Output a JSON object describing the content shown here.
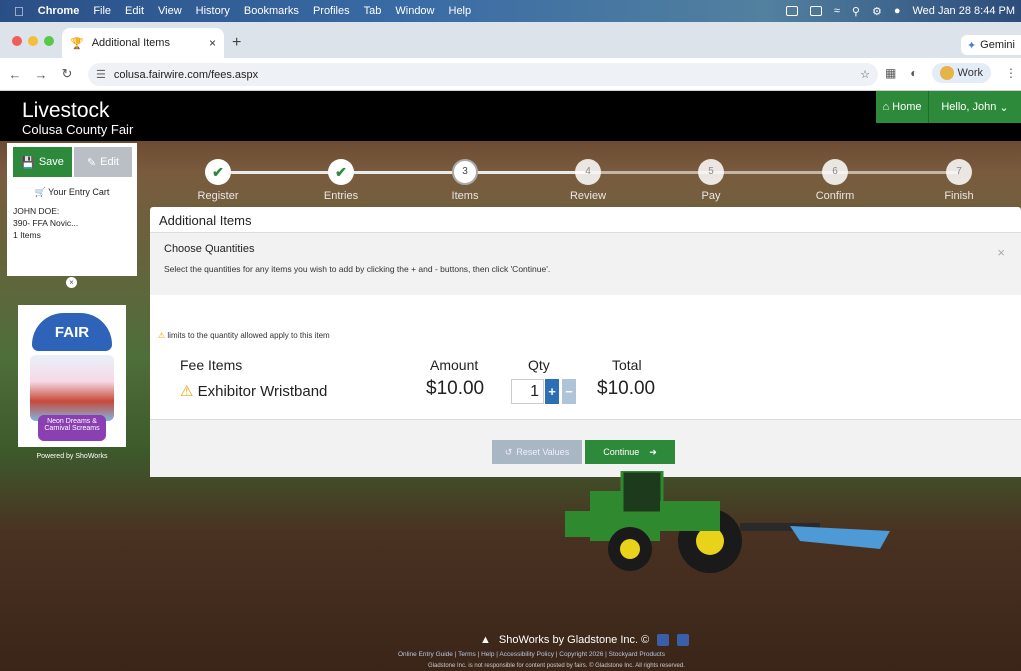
{
  "menubar": {
    "items": [
      "Chrome",
      "File",
      "Edit",
      "View",
      "History",
      "Bookmarks",
      "Profiles",
      "Tab",
      "Window",
      "Help"
    ],
    "datetime": "Wed Jan 28  8:44 PM"
  },
  "browser": {
    "tab_title": "Additional Items",
    "gemini_label": "Gemini",
    "url": "colusa.fairwire.com/fees.aspx",
    "profile_label": "Work"
  },
  "site": {
    "title": "Livestock",
    "subtitle": "Colusa County Fair",
    "home_label": "Home",
    "user_label": "Hello, John"
  },
  "sidebar": {
    "save_label": "Save",
    "edit_label": "Edit",
    "cart_label": "Your Entry Cart",
    "cart_lines": [
      "JOHN DOE:",
      "390- FFA Novic...",
      "1 Items"
    ],
    "logo_text": "FAIR",
    "logo_banner": "Neon Dreams & Carnival Screams",
    "powered_by": "Powered by ShoWorks"
  },
  "progress": {
    "steps": [
      {
        "label": "Register",
        "mark": "✔",
        "state": "done"
      },
      {
        "label": "Entries",
        "mark": "✔",
        "state": "done"
      },
      {
        "label": "Items",
        "mark": "3",
        "state": "cur"
      },
      {
        "label": "Review",
        "mark": "4",
        "state": "todo"
      },
      {
        "label": "Pay",
        "mark": "5",
        "state": "todo"
      },
      {
        "label": "Confirm",
        "mark": "6",
        "state": "todo"
      },
      {
        "label": "Finish",
        "mark": "7",
        "state": "todo"
      }
    ]
  },
  "panel": {
    "title": "Additional Items",
    "notice_title": "Choose Quantities",
    "notice_text": "Select the quantities for any items you wish to add by clicking the + and - buttons, then click 'Continue'.",
    "warning_text": "limits to the quantity allowed apply to this item",
    "headers": {
      "fee": "Fee Items",
      "amount": "Amount",
      "qty": "Qty",
      "total": "Total"
    },
    "item": {
      "name": "Exhibitor Wristband",
      "amount": "$10.00",
      "qty": "1",
      "total": "$10.00"
    },
    "reset_label": "Reset Values",
    "continue_label": "Continue"
  },
  "footer": {
    "brand": "ShoWorks by Gladstone Inc. ©",
    "links": "Online Entry Guide  |  Terms  |  Help  |  Accessibility Policy  |  Copyright 2026  |  Stockyard Products",
    "disclaimer": "Gladstone Inc. is not responsible for content posted by fairs. © Gladstone Inc. All rights reserved."
  },
  "colors": {
    "green": "#2d8a3a",
    "blue": "#2c6fb5",
    "warning": "#f0a500"
  }
}
